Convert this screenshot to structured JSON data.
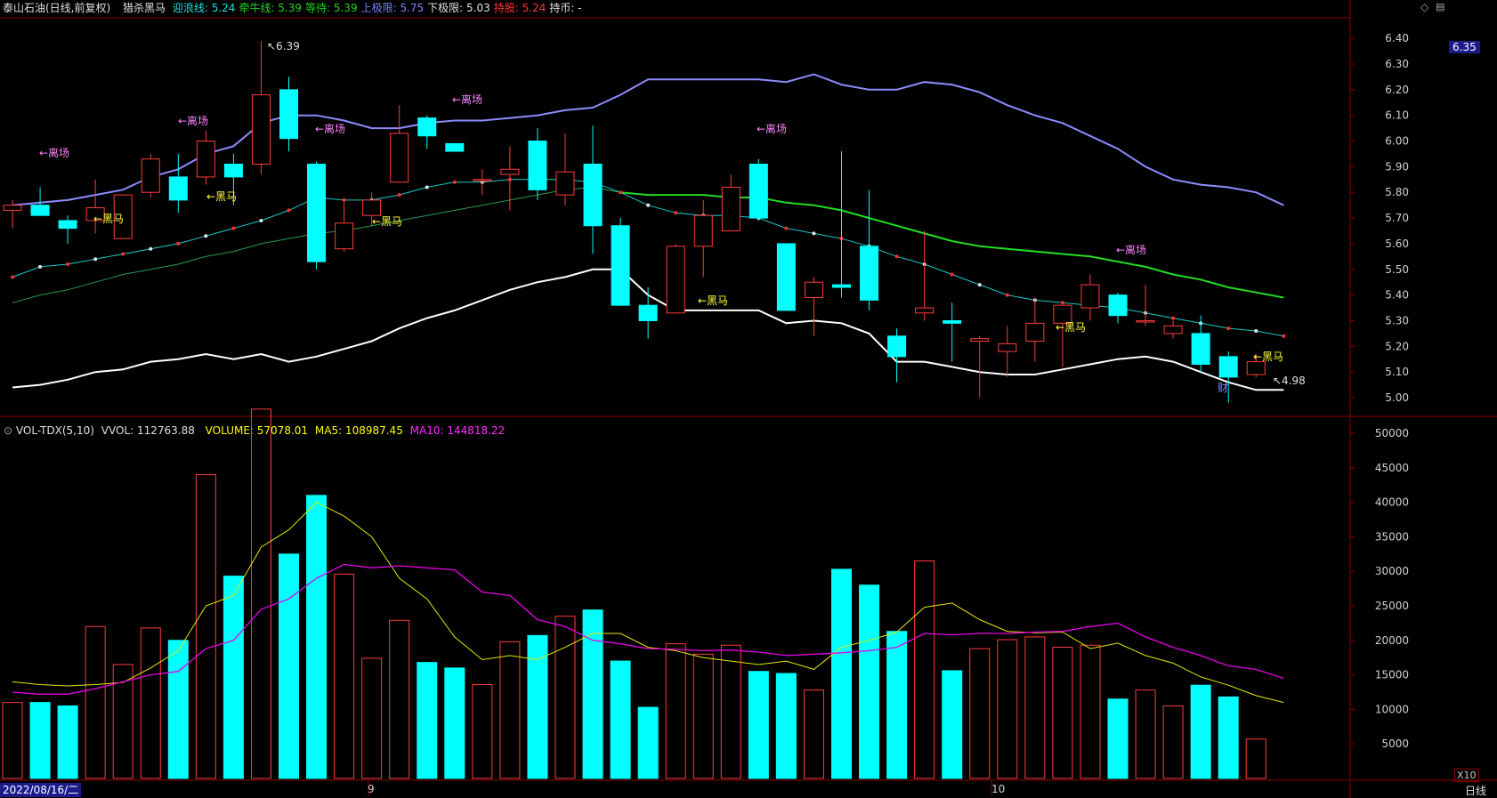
{
  "header": {
    "stock": "泰山石油(日线,前复权)",
    "indicator": "猎杀黑马",
    "items": [
      {
        "label": "迎浪线:",
        "value": "5.24",
        "color": "#19e0e0"
      },
      {
        "label": "牵牛线:",
        "value": "5.39",
        "color": "#1fd51f"
      },
      {
        "label": "等待:",
        "value": "5.39",
        "color": "#1fd51f"
      },
      {
        "label": "上极限:",
        "value": "5.75",
        "color": "#7b83ff"
      },
      {
        "label": "下极限:",
        "value": "5.03",
        "color": "#ffffff"
      },
      {
        "label": "持股:",
        "value": "5.24",
        "color": "#ff3030"
      },
      {
        "label": "持币:",
        "value": "-",
        "color": "#c8c8c8"
      }
    ]
  },
  "price_axis": {
    "labels": [
      "6.40",
      "6.30",
      "6.20",
      "6.10",
      "6.00",
      "5.90",
      "5.80",
      "5.70",
      "5.60",
      "5.50",
      "5.40",
      "5.30",
      "5.20",
      "5.10",
      "5.00"
    ],
    "current": "6.35"
  },
  "vol_header": {
    "name": "VOL-TDX(5,10)",
    "vvol": "VVOL: 112763.88",
    "volume": "VOLUME: 57078.01",
    "ma5": "MA5: 108987.45",
    "ma10": "MA10: 144818.22"
  },
  "vol_axis": {
    "labels": [
      "50000",
      "45000",
      "40000",
      "35000",
      "30000",
      "25000",
      "20000",
      "15000",
      "10000",
      "5000"
    ],
    "unit": "X10"
  },
  "bottom": {
    "date": "2022/08/16/二",
    "month_9": "9",
    "month_10": "10",
    "period": "日线"
  },
  "annotations": {
    "high": "6.39",
    "low": "4.98",
    "leave": "←离场",
    "horse": "←黑马",
    "fin": "财"
  },
  "colors": {
    "up": "#ff3b3b",
    "down": "#00ffff",
    "upper": "#8c8cff",
    "lower": "#ffffff",
    "green": "#22dd22",
    "cyan_line": "#19c8c8",
    "ma5": "#e6e600",
    "ma10": "#e600e6"
  },
  "chart_data": {
    "type": "candlestick",
    "candles": [
      {
        "o": 5.73,
        "c": 5.75,
        "h": 5.77,
        "l": 5.66,
        "v": 11000
      },
      {
        "o": 5.75,
        "c": 5.71,
        "h": 5.82,
        "l": 5.71,
        "v": 11000
      },
      {
        "o": 5.69,
        "c": 5.66,
        "h": 5.71,
        "l": 5.6,
        "v": 10500
      },
      {
        "o": 5.69,
        "c": 5.74,
        "h": 5.85,
        "l": 5.64,
        "v": 22000
      },
      {
        "o": 5.62,
        "c": 5.79,
        "h": 5.79,
        "l": 5.62,
        "v": 16500
      },
      {
        "o": 5.8,
        "c": 5.93,
        "h": 5.95,
        "l": 5.78,
        "v": 21800
      },
      {
        "o": 5.86,
        "c": 5.77,
        "h": 5.95,
        "l": 5.72,
        "v": 20000
      },
      {
        "o": 5.86,
        "c": 6.0,
        "h": 6.04,
        "l": 5.83,
        "v": 44000
      },
      {
        "o": 5.91,
        "c": 5.86,
        "h": 5.95,
        "l": 5.75,
        "v": 29300
      },
      {
        "o": 5.91,
        "c": 6.18,
        "h": 6.39,
        "l": 5.87,
        "v": 53500
      },
      {
        "o": 6.2,
        "c": 6.01,
        "h": 6.25,
        "l": 5.96,
        "v": 32500
      },
      {
        "o": 5.91,
        "c": 5.53,
        "h": 5.92,
        "l": 5.5,
        "v": 41000
      },
      {
        "o": 5.58,
        "c": 5.68,
        "h": 5.76,
        "l": 5.57,
        "v": 29600
      },
      {
        "o": 5.71,
        "c": 5.77,
        "h": 5.8,
        "l": 5.67,
        "v": 17400
      },
      {
        "o": 5.84,
        "c": 6.03,
        "h": 6.14,
        "l": 5.84,
        "v": 22900
      },
      {
        "o": 6.09,
        "c": 6.02,
        "h": 6.1,
        "l": 5.97,
        "v": 16800
      },
      {
        "o": 5.99,
        "c": 5.96,
        "h": 5.99,
        "l": 5.96,
        "v": 16000
      },
      {
        "o": 5.85,
        "c": 5.85,
        "h": 5.89,
        "l": 5.79,
        "v": 13600
      },
      {
        "o": 5.87,
        "c": 5.89,
        "h": 5.98,
        "l": 5.73,
        "v": 19800
      },
      {
        "o": 6.0,
        "c": 5.81,
        "h": 6.05,
        "l": 5.77,
        "v": 20700
      },
      {
        "o": 5.79,
        "c": 5.88,
        "h": 6.03,
        "l": 5.75,
        "v": 23500
      },
      {
        "o": 5.91,
        "c": 5.67,
        "h": 6.06,
        "l": 5.56,
        "v": 24400
      },
      {
        "o": 5.67,
        "c": 5.36,
        "h": 5.7,
        "l": 5.36,
        "v": 17000
      },
      {
        "o": 5.36,
        "c": 5.3,
        "h": 5.43,
        "l": 5.23,
        "v": 10300
      },
      {
        "o": 5.33,
        "c": 5.59,
        "h": 5.6,
        "l": 5.33,
        "v": 19500
      },
      {
        "o": 5.59,
        "c": 5.71,
        "h": 5.77,
        "l": 5.47,
        "v": 18000
      },
      {
        "o": 5.65,
        "c": 5.82,
        "h": 5.87,
        "l": 5.65,
        "v": 19300
      },
      {
        "o": 5.91,
        "c": 5.7,
        "h": 5.93,
        "l": 5.69,
        "v": 15500
      },
      {
        "o": 5.6,
        "c": 5.34,
        "h": 5.6,
        "l": 5.34,
        "v": 15200
      },
      {
        "o": 5.39,
        "c": 5.45,
        "h": 5.47,
        "l": 5.24,
        "v": 12800
      },
      {
        "o": 5.44,
        "c": 5.43,
        "h": 5.96,
        "l": 5.39,
        "v": 30300
      },
      {
        "o": 5.59,
        "c": 5.38,
        "h": 5.81,
        "l": 5.34,
        "v": 28000
      },
      {
        "o": 5.24,
        "c": 5.16,
        "h": 5.27,
        "l": 5.06,
        "v": 21300
      },
      {
        "o": 5.33,
        "c": 5.35,
        "h": 5.65,
        "l": 5.3,
        "v": 31500
      },
      {
        "o": 5.3,
        "c": 5.29,
        "h": 5.37,
        "l": 5.14,
        "v": 15600
      },
      {
        "o": 5.22,
        "c": 5.23,
        "h": 5.24,
        "l": 5.0,
        "v": 18800
      },
      {
        "o": 5.18,
        "c": 5.21,
        "h": 5.28,
        "l": 5.08,
        "v": 20100
      },
      {
        "o": 5.22,
        "c": 5.29,
        "h": 5.39,
        "l": 5.14,
        "v": 20500
      },
      {
        "o": 5.29,
        "c": 5.36,
        "h": 5.36,
        "l": 5.12,
        "v": 19000
      },
      {
        "o": 5.35,
        "c": 5.44,
        "h": 5.48,
        "l": 5.3,
        "v": 19300
      },
      {
        "o": 5.4,
        "c": 5.32,
        "h": 5.41,
        "l": 5.29,
        "v": 11500
      },
      {
        "o": 5.3,
        "c": 5.3,
        "h": 5.44,
        "l": 5.28,
        "v": 12800
      },
      {
        "o": 5.25,
        "c": 5.28,
        "h": 5.3,
        "l": 5.23,
        "v": 10500
      },
      {
        "o": 5.25,
        "c": 5.13,
        "h": 5.32,
        "l": 5.1,
        "v": 13500
      },
      {
        "o": 5.16,
        "c": 5.08,
        "h": 5.18,
        "l": 4.98,
        "v": 11800
      },
      {
        "o": 5.09,
        "c": 5.14,
        "h": 5.17,
        "l": 5.08,
        "v": 5700
      }
    ],
    "upper": [
      5.75,
      5.76,
      5.77,
      5.79,
      5.81,
      5.86,
      5.89,
      5.95,
      5.98,
      6.07,
      6.1,
      6.1,
      6.08,
      6.05,
      6.05,
      6.07,
      6.08,
      6.08,
      6.09,
      6.1,
      6.12,
      6.13,
      6.18,
      6.24,
      6.24,
      6.24,
      6.24,
      6.24,
      6.23,
      6.26,
      6.22,
      6.2,
      6.2,
      6.23,
      6.22,
      6.19,
      6.14,
      6.1,
      6.07,
      6.02,
      5.97,
      5.9,
      5.85,
      5.83,
      5.82,
      5.8,
      5.75
    ],
    "lower": [
      5.04,
      5.05,
      5.07,
      5.1,
      5.11,
      5.14,
      5.15,
      5.17,
      5.15,
      5.17,
      5.14,
      5.16,
      5.19,
      5.22,
      5.27,
      5.31,
      5.34,
      5.38,
      5.42,
      5.45,
      5.47,
      5.5,
      5.5,
      5.4,
      5.34,
      5.34,
      5.34,
      5.34,
      5.29,
      5.3,
      5.29,
      5.25,
      5.14,
      5.14,
      5.12,
      5.1,
      5.09,
      5.09,
      5.11,
      5.13,
      5.15,
      5.16,
      5.14,
      5.1,
      5.06,
      5.03,
      5.03
    ],
    "mid": [
      5.47,
      5.51,
      5.52,
      5.54,
      5.56,
      5.58,
      5.6,
      5.63,
      5.66,
      5.69,
      5.73,
      5.78,
      5.77,
      5.77,
      5.79,
      5.82,
      5.84,
      5.84,
      5.85,
      5.85,
      5.85,
      5.84,
      5.8,
      5.75,
      5.72,
      5.71,
      5.71,
      5.7,
      5.66,
      5.64,
      5.62,
      5.59,
      5.55,
      5.52,
      5.48,
      5.44,
      5.4,
      5.38,
      5.37,
      5.36,
      5.35,
      5.33,
      5.31,
      5.29,
      5.27,
      5.26,
      5.24
    ],
    "green": [
      5.37,
      5.4,
      5.42,
      5.45,
      5.48,
      5.5,
      5.52,
      5.55,
      5.57,
      5.6,
      5.62,
      5.64,
      5.65,
      5.67,
      5.69,
      5.71,
      5.73,
      5.75,
      5.77,
      5.79,
      5.81,
      5.82,
      5.8,
      5.79,
      5.79,
      5.79,
      5.78,
      5.78,
      5.76,
      5.75,
      5.73,
      5.7,
      5.67,
      5.64,
      5.61,
      5.59,
      5.58,
      5.57,
      5.56,
      5.55,
      5.53,
      5.51,
      5.48,
      5.46,
      5.43,
      5.41,
      5.39
    ],
    "ma5_vol": [
      14000,
      13600,
      13400,
      13600,
      13900,
      16000,
      18500,
      25000,
      26500,
      33500,
      36000,
      40000,
      38000,
      35000,
      29000,
      26000,
      20500,
      17200,
      17800,
      17200,
      19000,
      21000,
      21000,
      19000,
      18500,
      17500,
      17000,
      16500,
      17000,
      15800,
      19000,
      20000,
      21200,
      24800,
      25400,
      23000,
      21300,
      21100,
      21200,
      18800,
      19600,
      17800,
      16700,
      14700,
      13500,
      12000,
      11000
    ],
    "ma10_vol": [
      12500,
      12200,
      12200,
      13000,
      14000,
      15000,
      15500,
      18800,
      20000,
      24500,
      26000,
      29000,
      31000,
      30500,
      30800,
      30500,
      30200,
      27000,
      26500,
      23000,
      22000,
      20000,
      19500,
      18800,
      18700,
      18500,
      18600,
      18300,
      17800,
      18000,
      18200,
      18500,
      19000,
      21000,
      20800,
      21000,
      21000,
      21200,
      21300,
      22000,
      22500,
      20500,
      19000,
      17800,
      16300,
      15800,
      14500
    ]
  }
}
